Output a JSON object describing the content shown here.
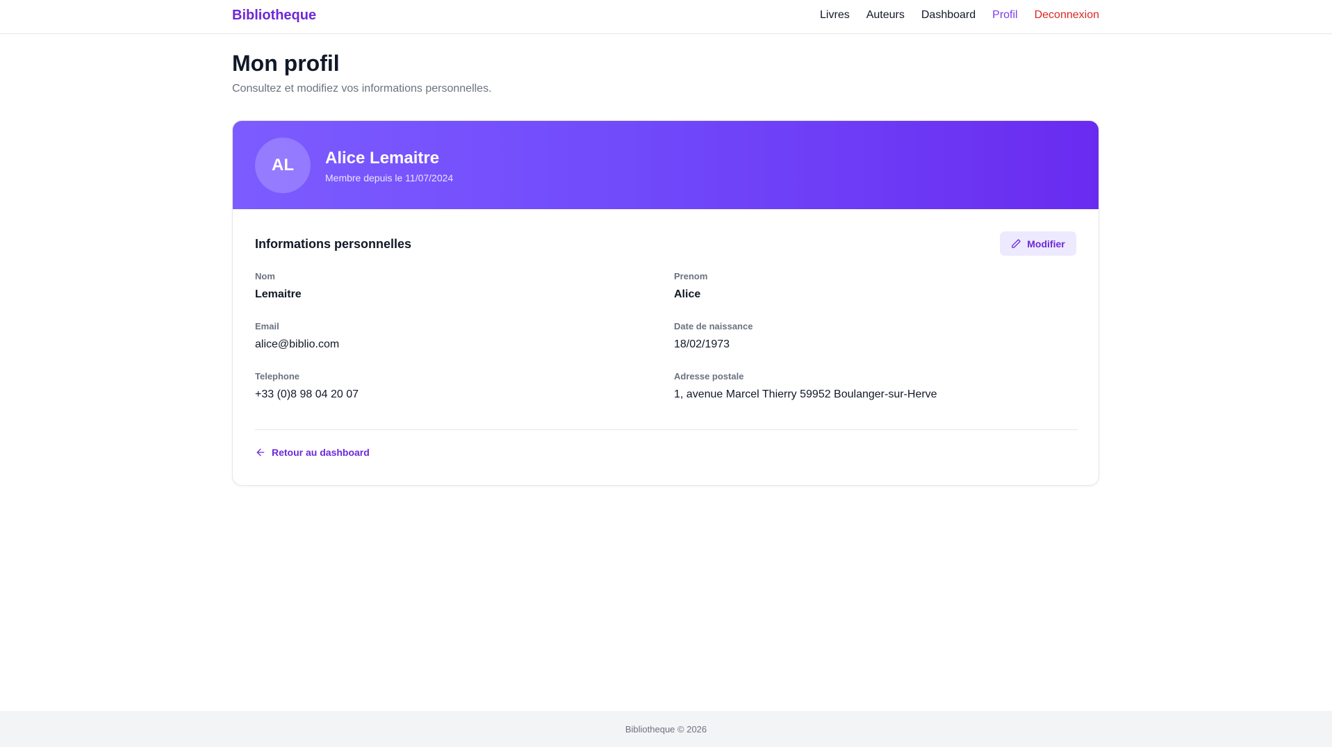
{
  "nav": {
    "brand": "Bibliotheque",
    "links": [
      "Livres",
      "Auteurs",
      "Dashboard",
      "Profil",
      "Deconnexion"
    ]
  },
  "page": {
    "title": "Mon profil",
    "subtitle": "Consultez et modifiez vos informations personnelles."
  },
  "profile": {
    "initials": "AL",
    "name": "Alice Lemaitre",
    "member_since": "Membre depuis le 11/07/2024"
  },
  "section": {
    "title": "Informations personnelles",
    "modify_label": "Modifier"
  },
  "fields": {
    "nom": {
      "label": "Nom",
      "value": "Lemaitre"
    },
    "prenom": {
      "label": "Prenom",
      "value": "Alice"
    },
    "email": {
      "label": "Email",
      "value": "alice@biblio.com"
    },
    "naissance": {
      "label": "Date de naissance",
      "value": "18/02/1973"
    },
    "telephone": {
      "label": "Telephone",
      "value": "+33 (0)8 98 04 20 07"
    },
    "adresse": {
      "label": "Adresse postale",
      "value": "1, avenue Marcel Thierry 59952 Boulanger-sur-Herve"
    }
  },
  "back_link": "Retour au dashboard",
  "footer": "Bibliotheque © 2026",
  "colors": {
    "accent": "#6d28d9",
    "logout": "#dc2626",
    "header_gradient_start": "#7c5cff",
    "header_gradient_end": "#6a2bf0"
  },
  "icons": {
    "modify": "pencil-icon",
    "back": "arrow-left-icon"
  }
}
